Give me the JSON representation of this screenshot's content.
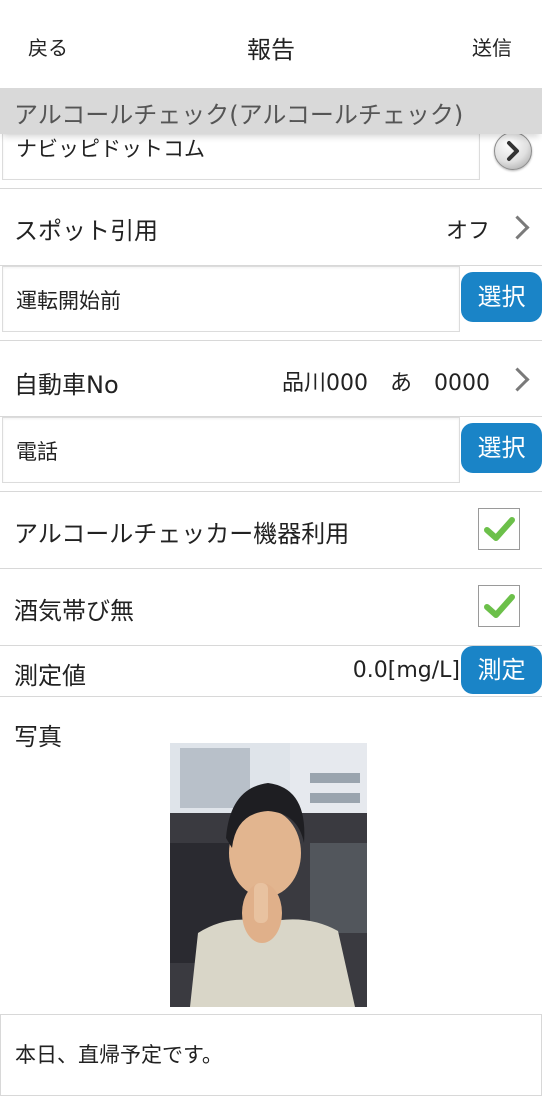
{
  "header": {
    "back_label": "戻る",
    "title": "報告",
    "send_label": "送信"
  },
  "section": {
    "title": "アルコールチェック(アルコールチェック)"
  },
  "company": {
    "value": "ナビッピドットコム"
  },
  "spot": {
    "label": "スポット引用",
    "value": "オフ"
  },
  "timing": {
    "value": "運転開始前",
    "select_label": "選択"
  },
  "vehicle": {
    "label": "自動車No",
    "value": "品川000　あ　0000"
  },
  "contact": {
    "value": "電話",
    "select_label": "選択"
  },
  "checker": {
    "label": "アルコールチェッカー機器利用",
    "checked": true
  },
  "no_alcohol": {
    "label": "酒気帯び無",
    "checked": true
  },
  "measure": {
    "label": "測定値",
    "value": "0.0[mg/L]",
    "button_label": "測定"
  },
  "photo": {
    "label": "写真"
  },
  "memo": {
    "value": "本日、直帰予定です。"
  },
  "colors": {
    "accent": "#1a84c7",
    "check": "#6cc04a",
    "section_bg": "#d9d9d9"
  },
  "icons": [
    "chevron-right-icon",
    "round-arrow-icon",
    "checkmark-icon"
  ]
}
